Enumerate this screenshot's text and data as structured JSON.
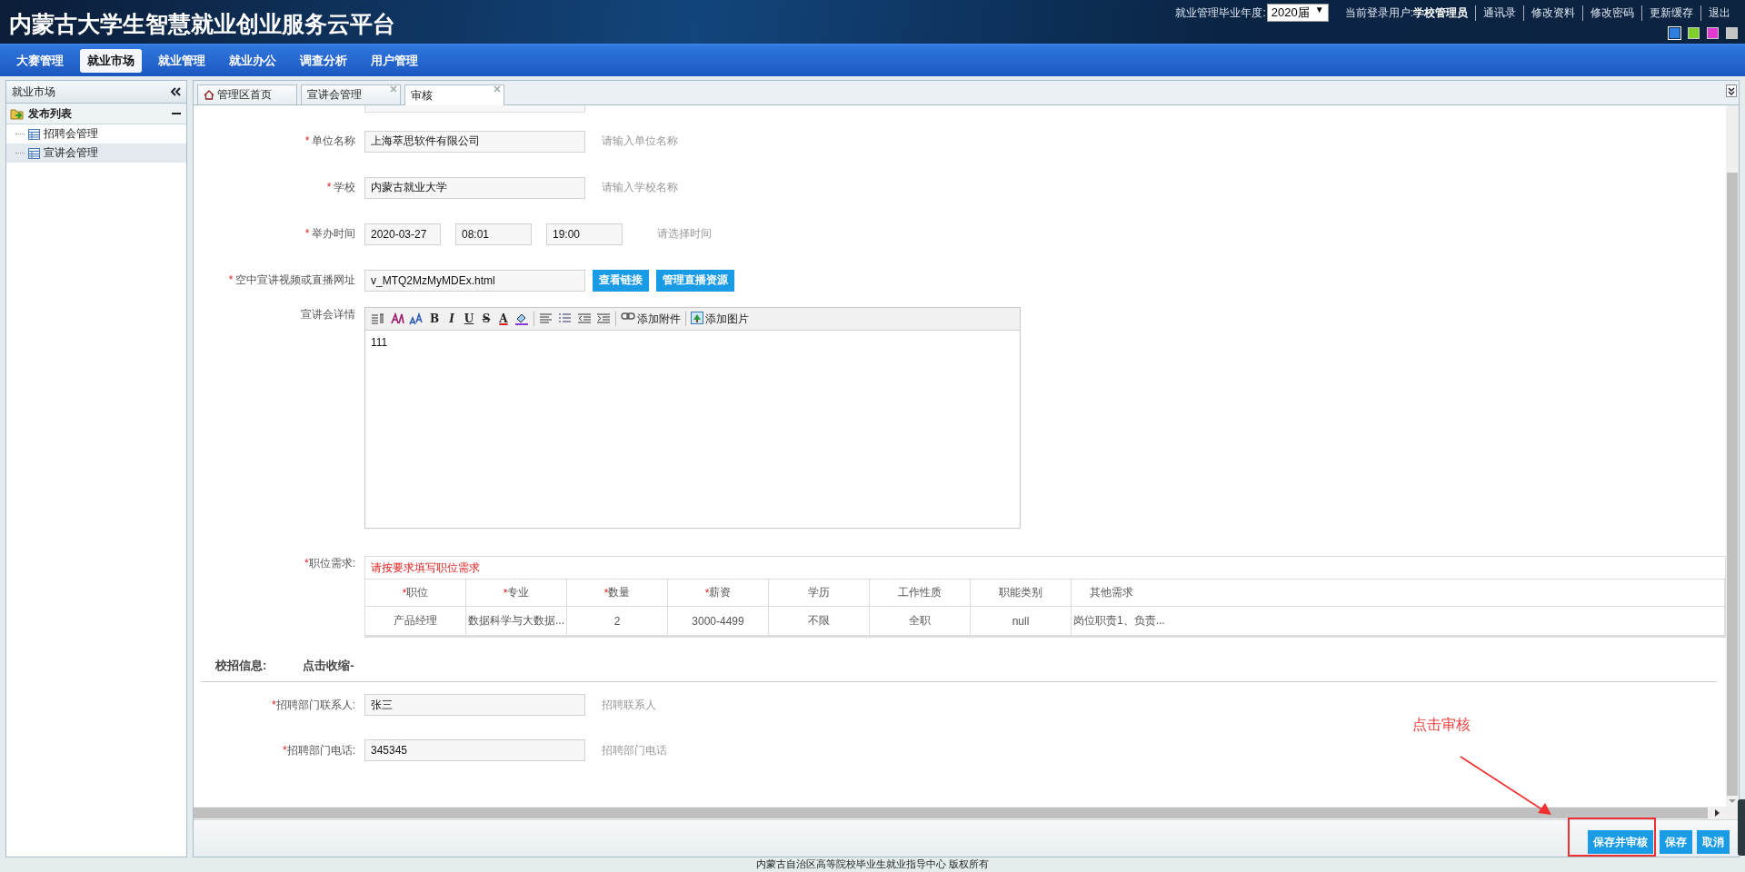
{
  "header": {
    "title": "内蒙古大学生智慧就业创业服务云平台",
    "year_label": "就业管理毕业年度:",
    "year_value": "2020届",
    "year_caret": "▼",
    "user": "当前登录用户:**学校管理员**",
    "links": [
      "通讯录",
      "修改资料",
      "修改密码",
      "更新缓存",
      "退出"
    ],
    "theme_colors": [
      {
        "color": "#2f7fe0",
        "selected": true
      },
      {
        "color": "#7fd12a",
        "selected": false
      },
      {
        "color": "#e03ad0",
        "selected": false
      },
      {
        "color": "#c4c4c4",
        "selected": false
      }
    ]
  },
  "nav": [
    {
      "label": "大赛管理",
      "selected": false
    },
    {
      "label": "就业市场",
      "selected": true
    },
    {
      "label": "就业管理",
      "selected": false
    },
    {
      "label": "就业办公",
      "selected": false
    },
    {
      "label": "调查分析",
      "selected": false
    },
    {
      "label": "用户管理",
      "selected": false
    }
  ],
  "sidebar": {
    "title": "就业市场",
    "group": {
      "label": "发布列表",
      "expanded": true,
      "children": [
        {
          "label": "招聘会管理",
          "selected": false
        },
        {
          "label": "宣讲会管理",
          "selected": true
        }
      ]
    }
  },
  "tabs": [
    {
      "label": "管理区首页",
      "kind": "home",
      "closable": false,
      "selected": false
    },
    {
      "label": "宣讲会管理",
      "kind": "page",
      "closable": true,
      "selected": false
    },
    {
      "label": "审核",
      "kind": "page",
      "closable": true,
      "selected": true
    }
  ],
  "fields": [
    {
      "kind": "text",
      "star": "*",
      "label": "单位名称",
      "value": "上海萃思软件有限公司",
      "hint": "请输入单位名称"
    },
    {
      "kind": "text",
      "star": "*",
      "label": "学校",
      "value": "内蒙古就业大学",
      "hint": "请输入学校名称"
    },
    {
      "kind": "time",
      "star": "*",
      "label": "举办时间",
      "values": [
        "2020-03-27",
        "08:01",
        "19:00"
      ],
      "hint": "请选择时间"
    },
    {
      "kind": "url",
      "star": "*",
      "label": "空中宣讲视频或直播网址",
      "value": "v_MTQ2MzMyMDEx.html",
      "buttons": [
        "查看链接",
        "管理直播资源"
      ]
    }
  ],
  "editor": {
    "label": "宣讲会详情",
    "tools": [
      {
        "kind": "paragraph"
      },
      {
        "kind": "font-family"
      },
      {
        "kind": "font-size"
      },
      {
        "kind": "glyph",
        "text": "B"
      },
      {
        "kind": "glyph",
        "text": "I"
      },
      {
        "kind": "glyph",
        "text": "U"
      },
      {
        "kind": "glyph",
        "text": "S"
      },
      {
        "kind": "glyph",
        "text": "A"
      },
      {
        "kind": "fill"
      },
      {
        "kind": "sep"
      },
      {
        "kind": "align"
      },
      {
        "kind": "list"
      },
      {
        "kind": "outdent"
      },
      {
        "kind": "indent"
      },
      {
        "kind": "sep"
      },
      {
        "kind": "link",
        "text": "添加附件"
      },
      {
        "kind": "sep"
      },
      {
        "kind": "image",
        "text": "添加图片"
      }
    ],
    "content": "111"
  },
  "positions": {
    "star": "*",
    "label": "职位需求:",
    "note": "请按要求填写职位需求",
    "columns": [
      {
        "star": "*",
        "label": "职位"
      },
      {
        "star": "*",
        "label": "专业"
      },
      {
        "star": "*",
        "label": "数量"
      },
      {
        "star": "*",
        "label": "薪资"
      },
      {
        "label": "学历"
      },
      {
        "label": "工作性质"
      },
      {
        "label": "职能类别"
      },
      {
        "label": "其他需求"
      }
    ],
    "rows": [
      [
        "产品经理",
        "数据科学与大数据...",
        "2",
        "3000-4499",
        "不限",
        "全职",
        "null",
        "岗位职责1、负责..."
      ]
    ]
  },
  "campus": {
    "title": "校招信息:",
    "toggle": "点击收缩-",
    "fields": [
      {
        "star": "*",
        "label": "招聘部门联系人:",
        "value": "张三",
        "hint": "招聘联系人"
      },
      {
        "star": "*",
        "label": "招聘部门电话:",
        "value": "345345",
        "hint": "招聘部门电话"
      }
    ]
  },
  "actions": [
    {
      "label": "保存并审核",
      "highlighted": true
    },
    {
      "label": "保存",
      "highlighted": false
    },
    {
      "label": "取消",
      "highlighted": false
    }
  ],
  "annotation": "点击审核",
  "footer": "内蒙古自治区高等院校毕业生就业指导中心 版权所有"
}
